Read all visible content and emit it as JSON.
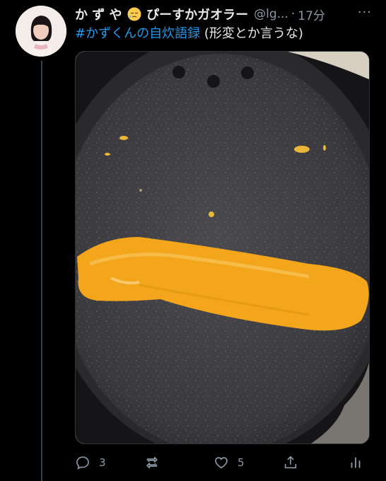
{
  "tweet": {
    "display_name_prefix": "か ず や",
    "display_name_suffix": "ぴーすかガオラー",
    "handle": "@lg...",
    "separator": "·",
    "time": "17分",
    "more_glyph": "···",
    "hashtag": "#かずくんの自炊語録",
    "text": " (形変とか言うな)",
    "emoji": "sleepy-face-emoji"
  },
  "actions": {
    "reply_count": "3",
    "retweet_count": "",
    "like_count": "5"
  },
  "colors": {
    "background": "#000000",
    "link": "#1d9bf0",
    "muted": "#8b98a5",
    "omelette": "#f3a51b"
  }
}
